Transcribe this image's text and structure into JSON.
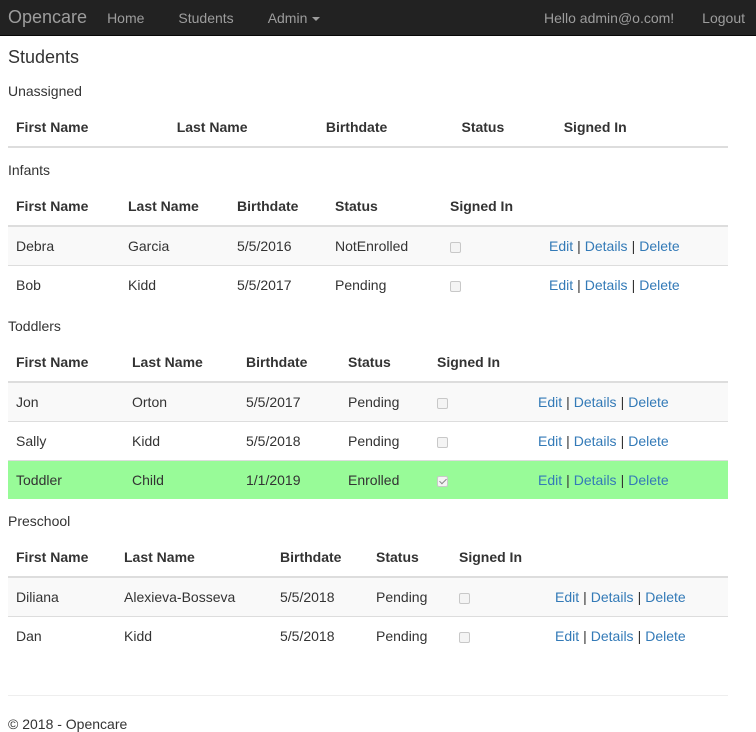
{
  "navbar": {
    "brand": "Opencare",
    "links": [
      "Home",
      "Students",
      "Admin"
    ],
    "greeting": "Hello admin@o.com!",
    "logout": "Logout",
    "background": "#222222"
  },
  "page": {
    "title": "Students"
  },
  "actions": {
    "edit": "Edit",
    "details": "Details",
    "delete": "Delete",
    "separator": "|"
  },
  "columns": [
    "First Name",
    "Last Name",
    "Birthdate",
    "Status",
    "Signed In"
  ],
  "sections": [
    {
      "title": "Unassigned",
      "rows": []
    },
    {
      "title": "Infants",
      "rows": [
        {
          "first": "Debra",
          "last": "Garcia",
          "birthdate": "5/5/2016",
          "status": "NotEnrolled",
          "signed_in": false
        },
        {
          "first": "Bob",
          "last": "Kidd",
          "birthdate": "5/5/2017",
          "status": "Pending",
          "signed_in": false
        }
      ]
    },
    {
      "title": "Toddlers",
      "rows": [
        {
          "first": "Jon",
          "last": "Orton",
          "birthdate": "5/5/2017",
          "status": "Pending",
          "signed_in": false
        },
        {
          "first": "Sally",
          "last": "Kidd",
          "birthdate": "5/5/2018",
          "status": "Pending",
          "signed_in": false
        },
        {
          "first": "Toddler",
          "last": "Child",
          "birthdate": "1/1/2019",
          "status": "Enrolled",
          "signed_in": true
        }
      ]
    },
    {
      "title": "Preschool",
      "rows": [
        {
          "first": "Diliana",
          "last": "Alexieva-Bosseva",
          "birthdate": "5/5/2018",
          "status": "Pending",
          "signed_in": false
        },
        {
          "first": "Dan",
          "last": "Kidd",
          "birthdate": "5/5/2018",
          "status": "Pending",
          "signed_in": false
        }
      ]
    }
  ],
  "footer": {
    "text": "© 2018 - Opencare"
  },
  "colors": {
    "enrolled_row": "#98fb98",
    "link": "#337ab7"
  }
}
